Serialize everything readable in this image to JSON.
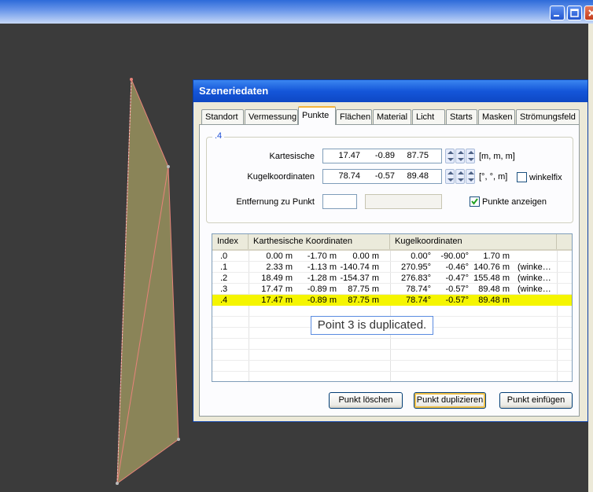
{
  "dialog": {
    "title": "Szeneriedaten"
  },
  "tabs": [
    {
      "label": "Standort"
    },
    {
      "label": "Vermessung"
    },
    {
      "label": "Punkte",
      "active": true
    },
    {
      "label": "Flächen"
    },
    {
      "label": "Material"
    },
    {
      "label": "Licht"
    },
    {
      "label": "Starts"
    },
    {
      "label": "Masken"
    },
    {
      "label": "Strömungsfeld"
    }
  ],
  "point_group": {
    "title": ".4",
    "cartesian": {
      "label": "Kartesische",
      "values": [
        "17.47",
        "-0.89",
        "87.75"
      ],
      "unit": "[m, m, m]"
    },
    "spherical": {
      "label": "Kugelkoordinaten",
      "values": [
        "78.74",
        "-0.57",
        "89.48"
      ],
      "unit": "[°, °, m]"
    },
    "winkelfix": {
      "label": "winkelfix",
      "checked": false
    },
    "distance": {
      "label": "Entfernung zu Punkt",
      "value": "",
      "result": ""
    },
    "show_points": {
      "label": "Punkte anzeigen",
      "checked": true
    }
  },
  "table": {
    "columns": [
      "Index",
      "Karthesische Koordinaten",
      "Kugelkoordinaten"
    ],
    "rows": [
      {
        "index": ".0",
        "x": "0.00 m",
        "y": "-1.70 m",
        "z": "0.00 m",
        "az": "0.00°",
        "el": "-90.00°",
        "r": "1.70 m",
        "note": ""
      },
      {
        "index": ".1",
        "x": "2.33 m",
        "y": "-1.13 m",
        "z": "-140.74 m",
        "az": "270.95°",
        "el": "-0.46°",
        "r": "140.76 m",
        "note": "(winke…"
      },
      {
        "index": ".2",
        "x": "18.49 m",
        "y": "-1.28 m",
        "z": "-154.37 m",
        "az": "276.83°",
        "el": "-0.47°",
        "r": "155.48 m",
        "note": "(winke…"
      },
      {
        "index": ".3",
        "x": "17.47 m",
        "y": "-0.89 m",
        "z": "87.75 m",
        "az": "78.74°",
        "el": "-0.57°",
        "r": "89.48 m",
        "note": "(winke…"
      },
      {
        "index": ".4",
        "x": "17.47 m",
        "y": "-0.89 m",
        "z": "87.75 m",
        "az": "78.74°",
        "el": "-0.57°",
        "r": "89.48 m",
        "note": "",
        "selected": true
      }
    ]
  },
  "callout": "Point 3 is duplicated.",
  "buttons": {
    "delete": "Punkt löschen",
    "duplicate": "Punkt duplizieren",
    "insert": "Punkt einfügen"
  },
  "colors": {
    "scene_background": "#3b3b3b",
    "shape_fill": "#8a8458",
    "shape_edge": "#e8837a",
    "selection": "#f5f500",
    "title_bar": "#1456d9"
  }
}
